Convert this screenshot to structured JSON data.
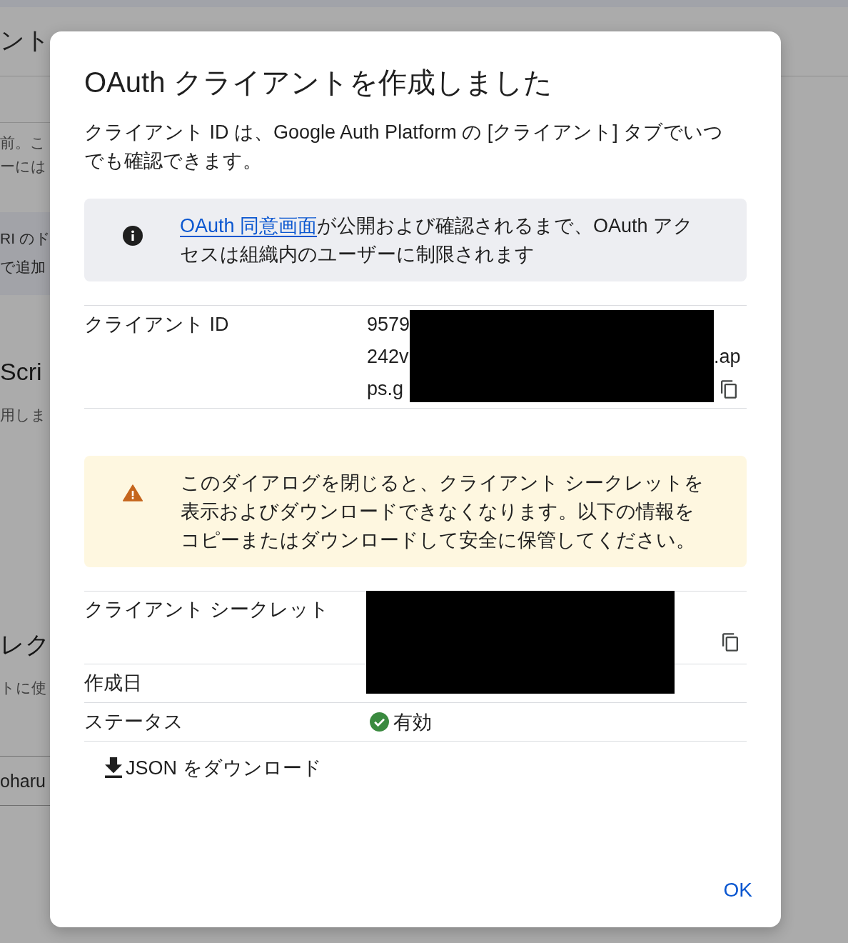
{
  "background": {
    "title": "ント",
    "sections": [
      {
        "kind": "text",
        "lines": [
          "前。こ",
          "ーには"
        ]
      },
      {
        "kind": "shaded",
        "lines": [
          "RI のド",
          "で追加"
        ]
      },
      {
        "kind": "heading",
        "lines": [
          "Scri",
          "用しま"
        ]
      },
      {
        "kind": "heading",
        "lines": [
          "レク",
          "トに使"
        ]
      },
      {
        "kind": "field",
        "lines": [
          "oharu"
        ]
      }
    ]
  },
  "dialog": {
    "title": "OAuth クライアントを作成しました",
    "description": "クライアント ID は、Google Auth Platform の [クライアント] タブでいつでも確認できます。",
    "info": {
      "link": "OAuth 同意画面",
      "text": "が公開および確認されるまで、OAuth アクセスは組織内のユーザーに制限されます"
    },
    "client_id": {
      "label": "クライアント ID",
      "redacted": true,
      "lines": [
        {
          "start": "9579"
        },
        {
          "start": "242v",
          "end": ".ap"
        },
        {
          "start": "ps.g"
        }
      ]
    },
    "warning": {
      "text": "このダイアログを閉じると、クライアント シークレットを表示およびダウンロードできなくなります。以下の情報をコピーまたはダウンロードして安全に保管してください。"
    },
    "details": [
      {
        "kind": "secret",
        "label": "クライアント シークレット"
      },
      {
        "kind": "date",
        "label": "作成日"
      }
    ],
    "details_redacted": true,
    "status": {
      "label": "ステータス",
      "value": "有効",
      "enabled": true
    },
    "download": {
      "label": "JSON をダウンロード"
    },
    "ok": {
      "label": "OK"
    }
  }
}
